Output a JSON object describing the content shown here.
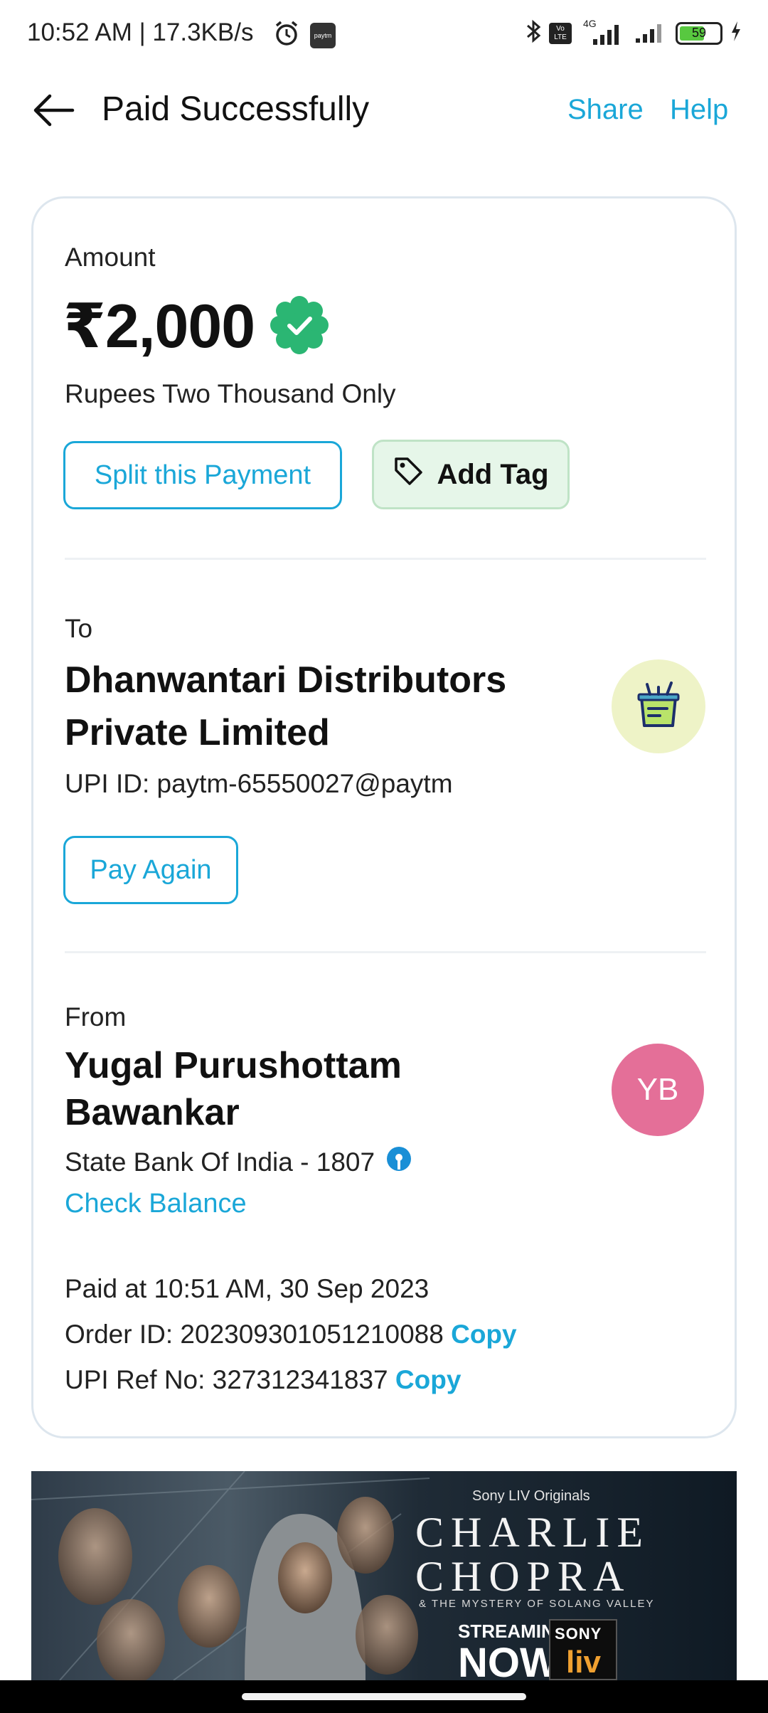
{
  "status_bar": {
    "time": "10:52 AM | 17.3KB/s",
    "network": "4G",
    "battery": "59",
    "volte": "Vo LTE",
    "app_badge": "paytm"
  },
  "header": {
    "title": "Paid Successfully",
    "share_label": "Share",
    "help_label": "Help"
  },
  "amount": {
    "label": "Amount",
    "value": "₹2,000",
    "words": "Rupees Two Thousand Only",
    "split_label": "Split this Payment",
    "tag_label": "Add Tag"
  },
  "to": {
    "label": "To",
    "name_line1": "Dhanwantari Distributors",
    "name_line2": "Private Limited",
    "upi_id": "UPI ID: paytm-65550027@paytm",
    "pay_again_label": "Pay Again"
  },
  "from": {
    "label": "From",
    "name_line1": "Yugal Purushottam",
    "name_line2": "Bawankar",
    "initials": "YB",
    "bank": "State Bank Of India - 1807",
    "check_balance_label": "Check Balance"
  },
  "details": {
    "paid_at": "Paid at 10:51 AM, 30 Sep 2023",
    "order_id": "Order ID: 202309301051210088",
    "upi_ref": "UPI Ref No: 327312341837",
    "copy_label": "Copy"
  },
  "banner": {
    "origin": "Sony LIV Originals",
    "title_line1": "CHARLIE",
    "title_line2": "CHOPRA",
    "subtitle": "& THE MYSTERY OF SOLANG VALLEY",
    "streaming": "STREAMING",
    "now": "NOW",
    "brand1": "SONY",
    "brand2": "liv"
  },
  "colors": {
    "accent": "#1aa7d8",
    "success": "#2bb673",
    "tag_bg": "#e6f6e9",
    "avatar_user": "#e46f98"
  }
}
